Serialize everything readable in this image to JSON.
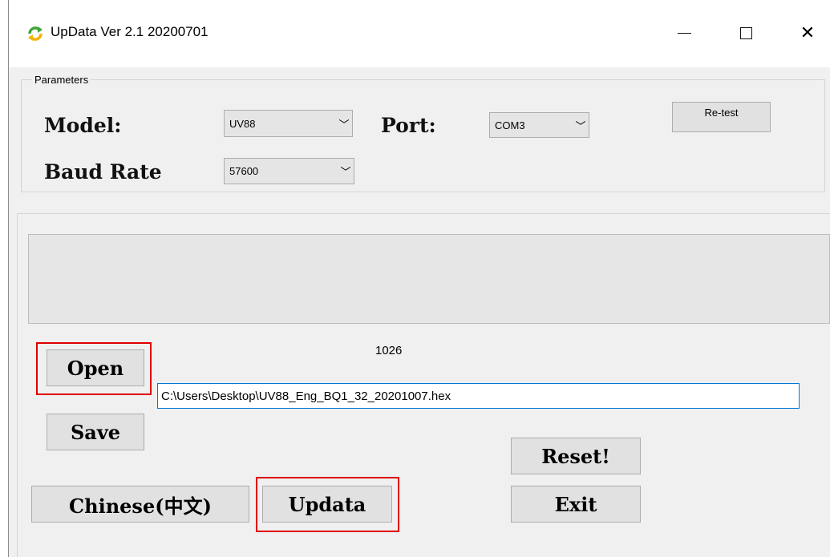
{
  "window": {
    "title": "UpData  Ver 2.1 20200701",
    "icon": "refresh-arrows-icon",
    "controls": [
      "minimize-icon",
      "maximize-icon",
      "close-icon"
    ],
    "close_glyph": "✕"
  },
  "parameters": {
    "group_title": "Parameters",
    "model_label": "Model:",
    "model_value": "UV88",
    "port_label": "Port:",
    "port_value": "COM3",
    "baud_label": "Baud Rate",
    "baud_value": "57600",
    "retest_label": "Re-test",
    "dropdown_glyph": "﹀"
  },
  "main": {
    "counter": "1026",
    "file_path": "C:\\Users\\Desktop\\UV88_Eng_BQ1_32_20201007.hex",
    "open_label": "Open",
    "save_label": "Save",
    "chinese_label": "Chinese(中文)",
    "updata_label": "Updata",
    "reset_label": "Reset!",
    "exit_label": "Exit"
  },
  "colors": {
    "highlight": "#e00000",
    "focus_border": "#0078d7",
    "icon_green": "#3fa535",
    "icon_yellow": "#f0b400"
  }
}
